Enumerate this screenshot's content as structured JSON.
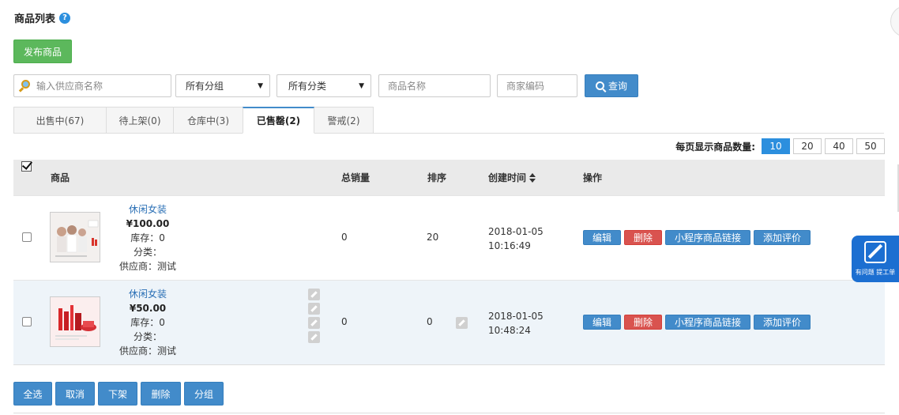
{
  "header": {
    "title": "商品列表",
    "help_icon": "?"
  },
  "toolbar": {
    "publish_label": "发布商品"
  },
  "filters": {
    "supplier_placeholder": "输入供应商名称",
    "group_value": "所有分组",
    "category_value": "所有分类",
    "name_placeholder": "商品名称",
    "code_placeholder": "商家编码",
    "query_label": "查询",
    "caret": "▼"
  },
  "tabs": [
    {
      "label": "出售中(67)"
    },
    {
      "label": "待上架(0)"
    },
    {
      "label": "仓库中(3)"
    },
    {
      "label": "已售罄(2)"
    },
    {
      "label": "警戒(2)"
    }
  ],
  "pagination": {
    "label": "每页显示商品数量:",
    "options": [
      "10",
      "20",
      "40",
      "50"
    ],
    "selected": "10"
  },
  "table": {
    "headers": {
      "product": "商品",
      "sales": "总销量",
      "order": "排序",
      "created": "创建时间",
      "actions": "操作"
    },
    "rows": [
      {
        "name": "休闲女装",
        "price": "¥100.00",
        "stock": "库存：0",
        "category": "分类：",
        "supplier": "供应商：测试",
        "sales": "0",
        "order": "20",
        "date": "2018-01-05",
        "time": "10:16:49"
      },
      {
        "name": "休闲女装",
        "price": "¥50.00",
        "stock": "库存：0",
        "category": "分类：",
        "supplier": "供应商：测试",
        "sales": "0",
        "order": "0",
        "date": "2018-01-05",
        "time": "10:48:24"
      }
    ],
    "actions": {
      "edit": "编辑",
      "delete": "删除",
      "mini_link": "小程序商品链接",
      "add_review": "添加评价"
    }
  },
  "bulk": {
    "select_all": "全选",
    "cancel": "取消",
    "offline": "下架",
    "delete": "删除",
    "group": "分组"
  },
  "float_help": {
    "label": "有问题 提工单"
  },
  "colors": {
    "primary": "#428bca",
    "success": "#5cb85c",
    "danger": "#d9534f",
    "float": "#1c6fd1"
  }
}
